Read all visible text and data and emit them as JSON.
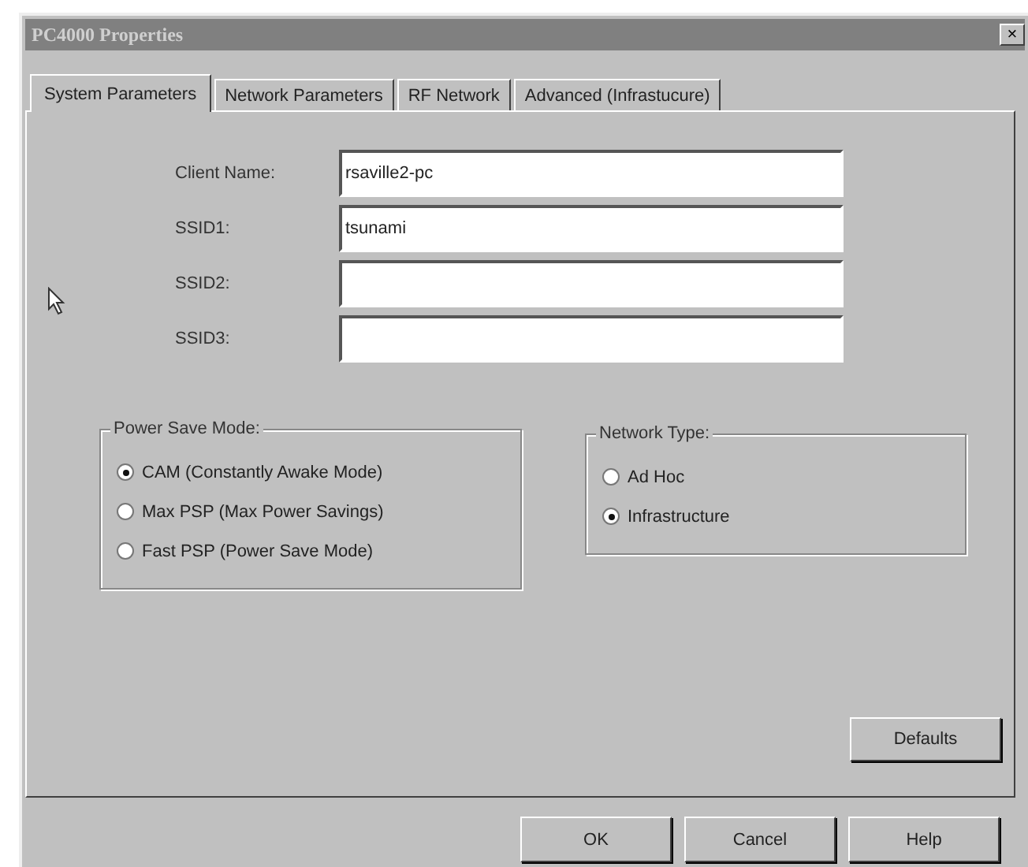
{
  "window": {
    "title": "PC4000 Properties",
    "close": "×"
  },
  "tabs": [
    {
      "label": "System Parameters",
      "selected": true
    },
    {
      "label": "Network Parameters",
      "selected": false
    },
    {
      "label": "RF Network",
      "selected": false
    },
    {
      "label": "Advanced (Infrastucure)",
      "selected": false
    }
  ],
  "fields": [
    {
      "label": "Client Name:",
      "value": "rsaville2-pc"
    },
    {
      "label": "SSID1:",
      "value": "tsunami"
    },
    {
      "label": "SSID2:"
    },
    {
      "label": "SSID3:"
    }
  ],
  "power_save_mode": {
    "title": "Power Save Mode:",
    "options": [
      {
        "label": "CAM (Constantly Awake Mode)",
        "selected": true
      },
      {
        "label": "Max PSP (Max Power Savings)",
        "selected": false
      },
      {
        "label": "Fast PSP (Power Save Mode)",
        "selected": false
      }
    ]
  },
  "network_type": {
    "title": "Network Type:",
    "options": [
      {
        "label": "Ad Hoc",
        "selected": false
      },
      {
        "label": "Infrastructure",
        "selected": true
      }
    ]
  },
  "defaults_button": "Defaults",
  "buttons": [
    "OK",
    "Cancel",
    "Help"
  ]
}
